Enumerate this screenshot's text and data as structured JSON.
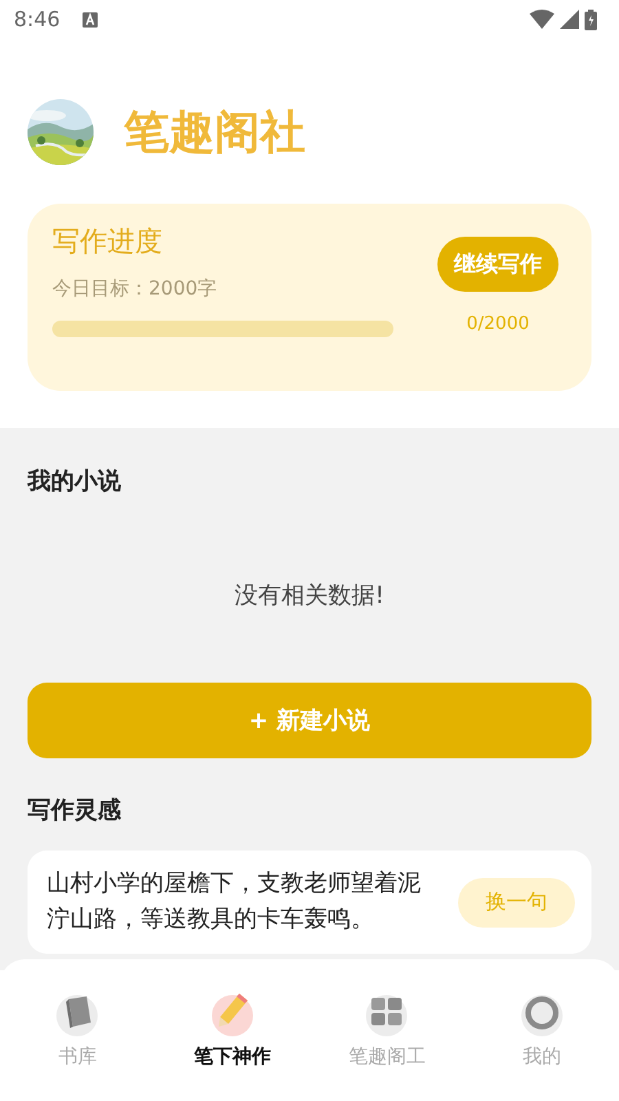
{
  "status_bar": {
    "time": "8:46"
  },
  "header": {
    "title": "笔趣阁社"
  },
  "progress_card": {
    "title": "写作进度",
    "goal": "今日目标：2000字",
    "level": 0,
    "reading": "0/2000",
    "button": "继续写作"
  },
  "my_novels": {
    "title": "我的小说",
    "empty_text": "没有相关数据!",
    "new_button": "+ 新建小说"
  },
  "inspiration": {
    "title": "写作灵感",
    "quote": "山村小学的屋檐下，支教老师望着泥泞山路，等送教具的卡车轰鸣。",
    "button": "换一句"
  },
  "bottom_nav": [
    {
      "label": "书库",
      "selected": false
    },
    {
      "label": "笔下神作",
      "selected": true
    },
    {
      "label": "笔趣阁工",
      "selected": false
    },
    {
      "label": "我的",
      "selected": false
    }
  ]
}
